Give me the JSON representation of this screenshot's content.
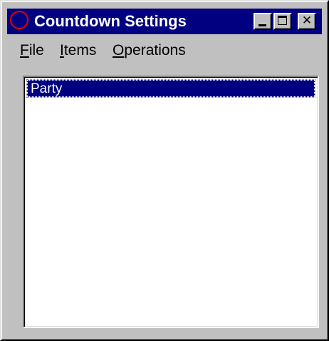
{
  "window": {
    "title": "Countdown Settings"
  },
  "menu": {
    "file": {
      "mnemonic": "F",
      "rest": "ile"
    },
    "items": {
      "mnemonic": "I",
      "rest": "tems"
    },
    "operations": {
      "mnemonic": "O",
      "rest": "perations"
    }
  },
  "list": {
    "items": [
      "Party"
    ],
    "selected_index": 0
  },
  "icons": {
    "app": "countdown-circle-icon",
    "minimize": "minimize-icon",
    "maximize": "maximize-icon",
    "close": "close-icon"
  },
  "colors": {
    "title_bar": "#000080",
    "selection": "#000080",
    "window_face": "#c0c0c0",
    "app_icon_ring": "#e00000"
  }
}
